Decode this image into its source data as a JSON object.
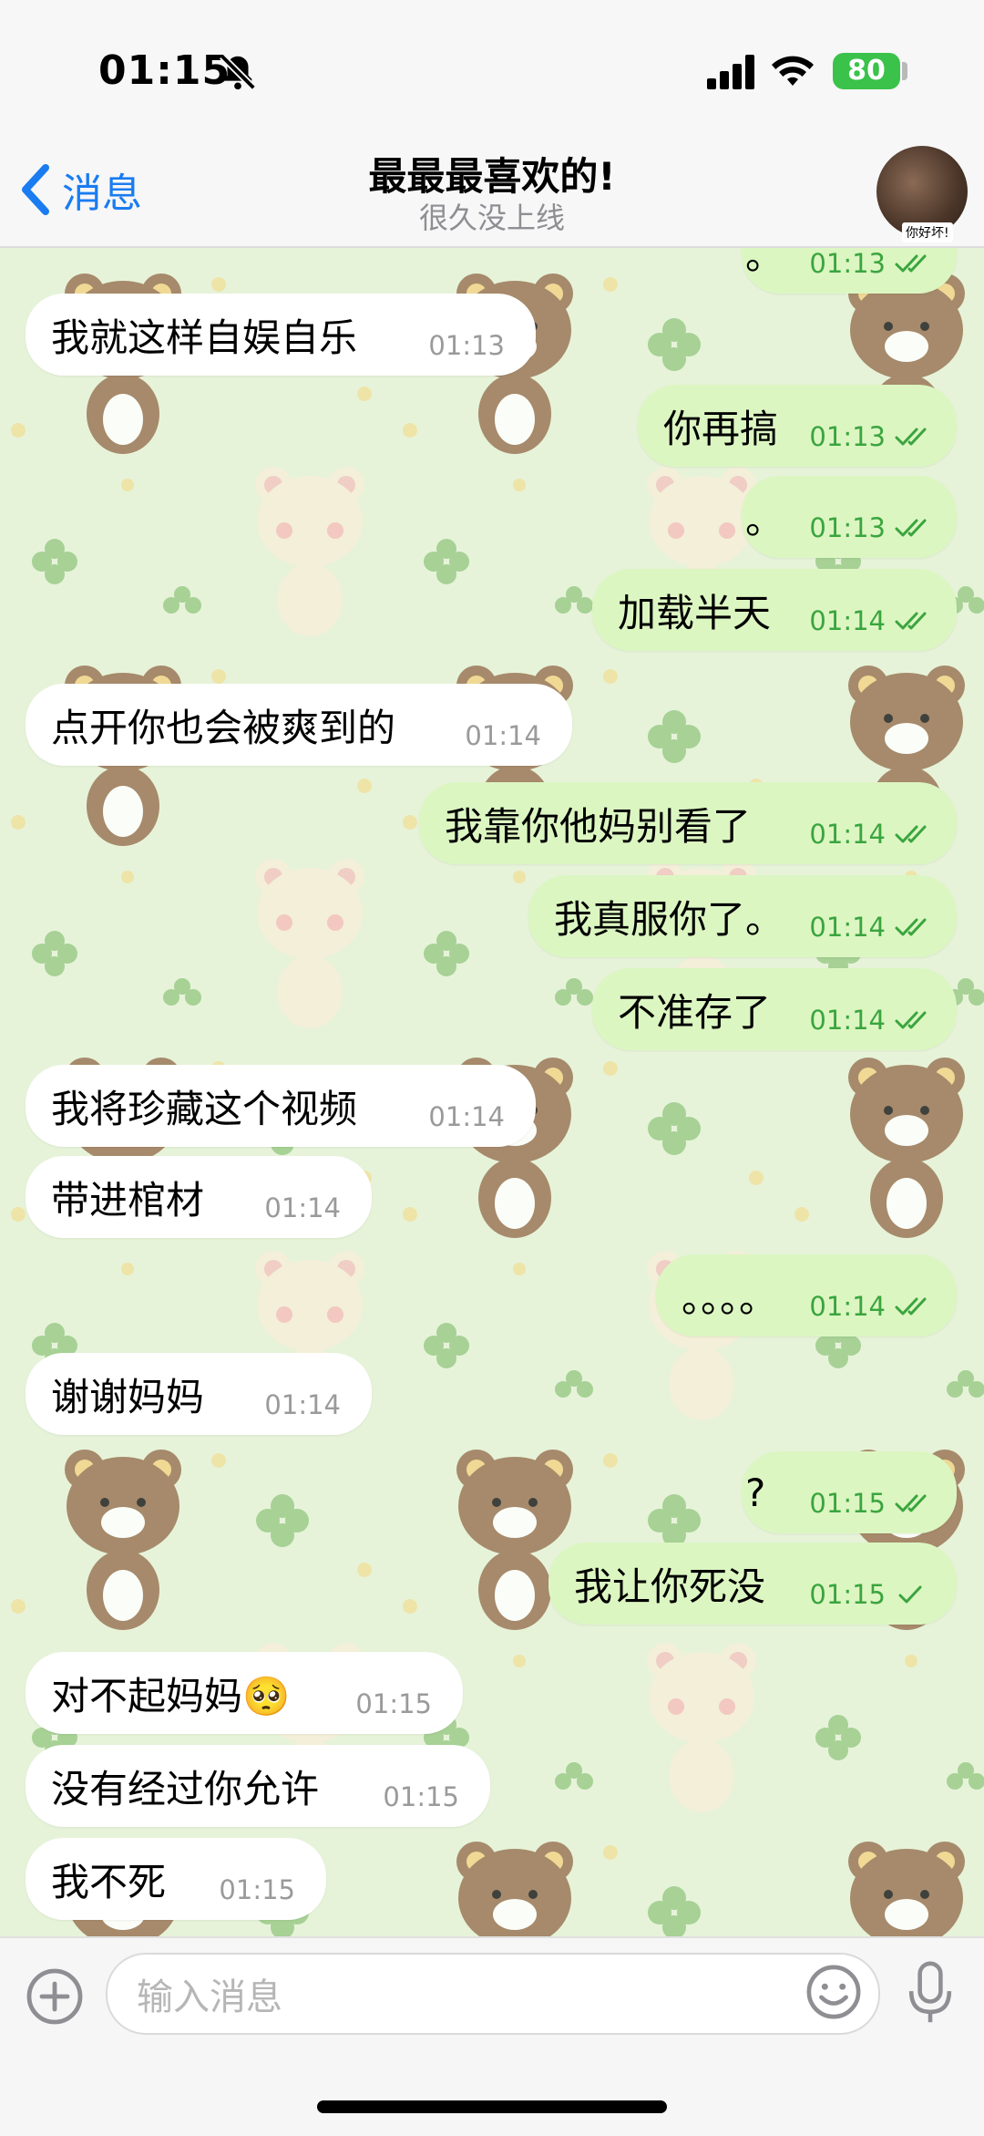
{
  "status": {
    "time": "01:15",
    "battery": "80"
  },
  "nav": {
    "back_label": "消息",
    "title": "最最最喜欢的!",
    "subtitle": "很久没上线",
    "avatar_caption": "你好坏!"
  },
  "messages": [
    {
      "side": "out",
      "text": "。",
      "time": "01:13",
      "read": true
    },
    {
      "side": "in",
      "text": "我就这样自娱自乐",
      "time": "01:13"
    },
    {
      "side": "out",
      "text": "你再搞",
      "time": "01:13",
      "read": true
    },
    {
      "side": "out",
      "text": "。",
      "time": "01:13",
      "read": true
    },
    {
      "side": "out",
      "text": "加载半天",
      "time": "01:14",
      "read": true
    },
    {
      "side": "in",
      "text": "点开你也会被爽到的",
      "time": "01:14"
    },
    {
      "side": "out",
      "text": "我靠你他妈别看了",
      "time": "01:14",
      "read": true
    },
    {
      "side": "out",
      "text": "我真服你了。",
      "time": "01:14",
      "read": true
    },
    {
      "side": "out",
      "text": "不准存了",
      "time": "01:14",
      "read": true
    },
    {
      "side": "in",
      "text": "我将珍藏这个视频",
      "time": "01:14"
    },
    {
      "side": "in",
      "text": "带进棺材",
      "time": "01:14"
    },
    {
      "side": "out",
      "text": "。。。。",
      "time": "01:14",
      "read": true
    },
    {
      "side": "in",
      "text": "谢谢妈妈",
      "time": "01:14"
    },
    {
      "side": "out",
      "text": "?",
      "time": "01:15",
      "read": true
    },
    {
      "side": "out",
      "text": "我让你死没",
      "time": "01:15",
      "read": false
    },
    {
      "side": "in",
      "text": "对不起妈妈🥺",
      "time": "01:15"
    },
    {
      "side": "in",
      "text": "没有经过你允许",
      "time": "01:15"
    },
    {
      "side": "in",
      "text": "我不死",
      "time": "01:15"
    }
  ],
  "input": {
    "placeholder": "输入消息"
  },
  "colors": {
    "accent": "#1a7cf0",
    "out_bubble": "#dcf6c2",
    "in_bubble": "#ffffff",
    "out_meta": "#3aa53e",
    "wallpaper": "#e4f2d6"
  },
  "icons": {
    "back": "chevron-left-icon",
    "mute": "bell-slash-icon",
    "attach": "plus-circle-icon",
    "emoji": "smiley-icon",
    "voice": "microphone-icon"
  }
}
